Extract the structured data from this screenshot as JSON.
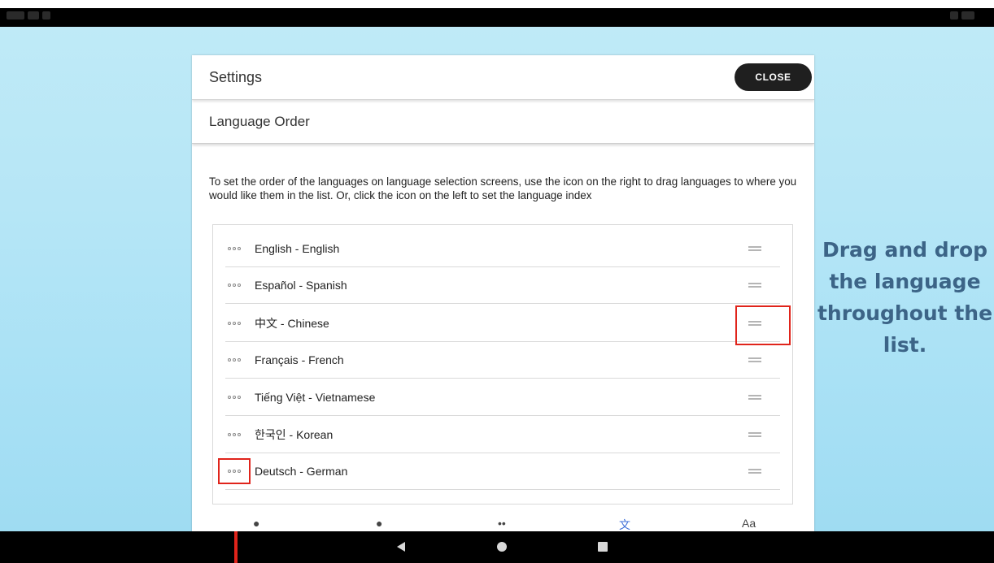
{
  "panel": {
    "title": "Settings",
    "close_label": "CLOSE"
  },
  "section": {
    "title": "Language Order",
    "instructions": "To set the order of the languages on language selection screens, use the icon on the right to drag languages to where you would like them in the list. Or, click the icon on the left to set the language index"
  },
  "languages": [
    {
      "label": "English - English"
    },
    {
      "label": "Español - Spanish"
    },
    {
      "label": "中文 - Chinese"
    },
    {
      "label": "Français - French"
    },
    {
      "label": "Tiếng Việt - Vietnamese"
    },
    {
      "label": "한국인 - Korean"
    },
    {
      "label": "Deutsch - German"
    }
  ],
  "annotation": {
    "text": "Drag and drop the language throughout the list."
  },
  "icons": {
    "row_index": "dots-icon",
    "row_drag": "drag-handle-icon",
    "nav_back": "back-icon",
    "nav_home": "home-icon",
    "nav_recent": "recent-apps-icon"
  },
  "colors": {
    "highlight": "#e0241b",
    "annotation_text": "#3c6487",
    "close_button": "#1f1f1f",
    "background": "#b6e6f6"
  }
}
